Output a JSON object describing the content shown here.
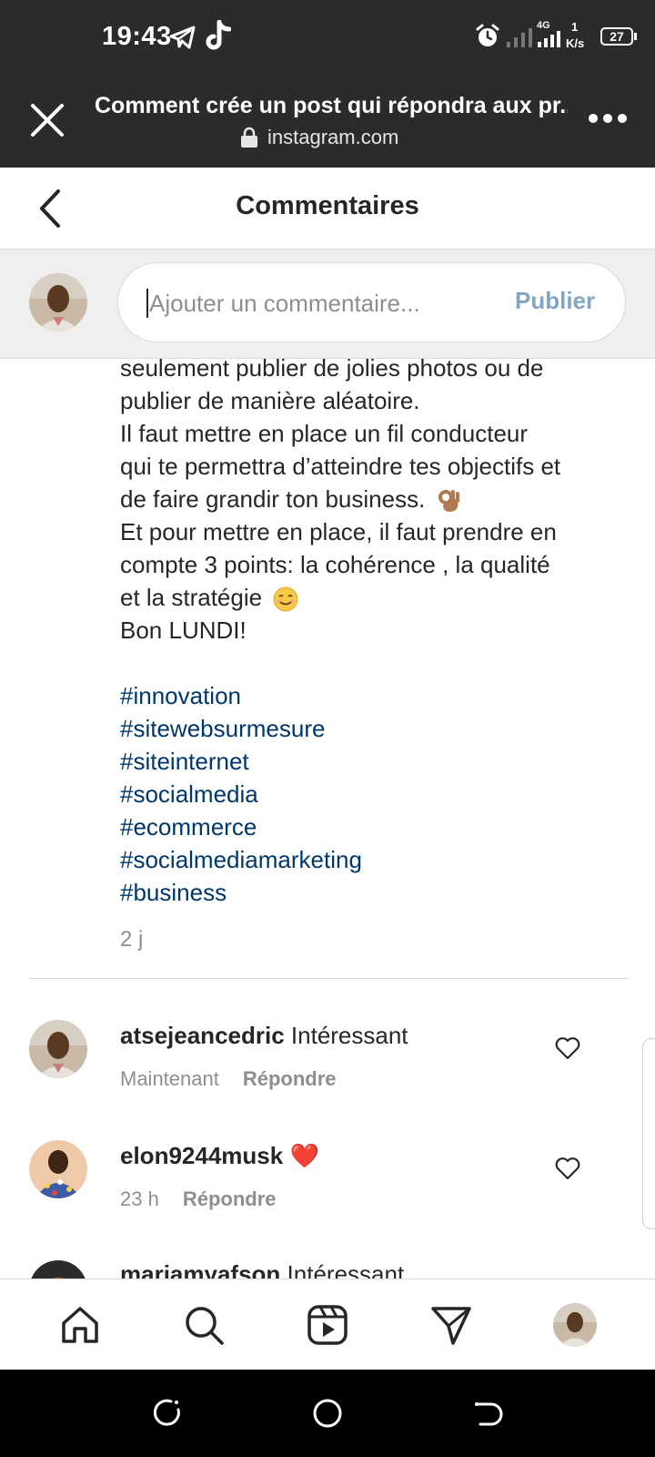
{
  "status_bar": {
    "time": "19:43",
    "network": "4G",
    "speed_value": "1",
    "speed_unit": "K/s",
    "battery": "27"
  },
  "browser": {
    "title": "Comment crée un post qui répondra aux pr...",
    "url": "instagram.com"
  },
  "header": {
    "title": "Commentaires"
  },
  "composer": {
    "placeholder": "Ajouter un commentaire...",
    "publish_label": "Publier"
  },
  "caption": {
    "lines": [
      "seulement publier de jolies photos ou de",
      "publier de manière aléatoire.",
      "Il faut mettre en place un fil conducteur",
      "qui te permettra d’atteindre tes objectifs et",
      "de faire grandir ton business.",
      "Et pour mettre en place, il faut prendre en",
      "compte 3 points: la cohérence , la qualité",
      "et la stratégie",
      "Bon LUNDI!"
    ],
    "hashtags": [
      "#innovation",
      "#sitewebsurmesure",
      "#siteinternet",
      "#socialmedia",
      "#ecommerce",
      "#socialmediamarketing",
      "#business"
    ],
    "age": "2 j"
  },
  "comments": [
    {
      "username": "atsejeancedric",
      "text": "Intéressant",
      "time": "Maintenant",
      "reply_label": "Répondre"
    },
    {
      "username": "elon9244musk",
      "text": "❤️",
      "time": "23 h",
      "reply_label": "Répondre"
    },
    {
      "username": "mariamyafson",
      "text": "Intéressant"
    }
  ],
  "colors": {
    "status_bar_bg": "#2b2b2b",
    "hashtag": "#00376b",
    "publish_disabled": "#82a6c4",
    "muted_text": "#8e8e8e"
  },
  "icons": {
    "bottom_nav": [
      "home-icon",
      "search-icon",
      "reels-icon",
      "direct-message-icon",
      "profile-avatar"
    ]
  }
}
